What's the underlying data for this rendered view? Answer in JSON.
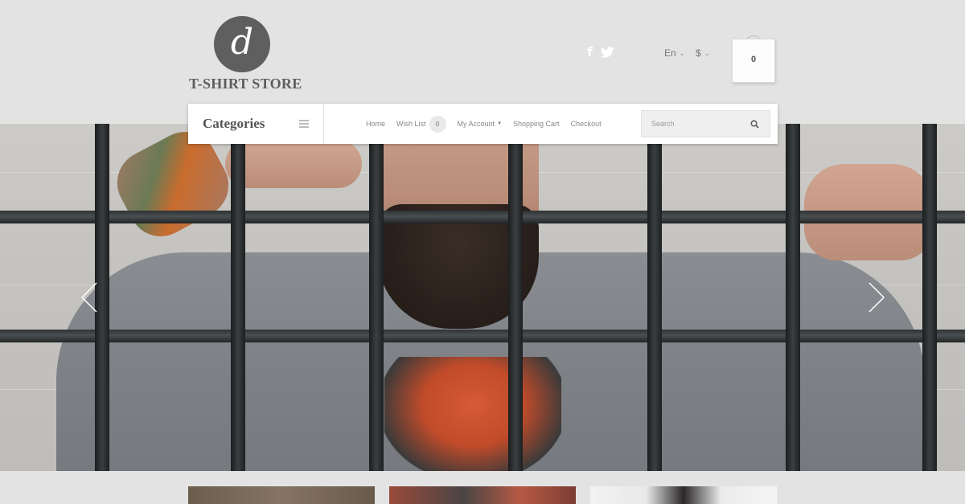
{
  "header": {
    "logo_letter": "d",
    "store_name": "T-SHIRT STORE",
    "language": "En",
    "currency": "$",
    "cart_count": "0",
    "social": {
      "facebook_icon": "f",
      "twitter_icon": "twitter-bird"
    }
  },
  "nav": {
    "categories_label": "Categories",
    "menu": {
      "home": "Home",
      "wishlist": "Wish List",
      "wishlist_count": "0",
      "account": "My Account",
      "cart": "Shopping Cart",
      "checkout": "Checkout"
    },
    "search": {
      "placeholder": "Search",
      "icon": "search-icon"
    }
  },
  "slider": {
    "prev_icon": "chevron-left-icon",
    "next_icon": "chevron-right-icon"
  },
  "colors": {
    "background": "#e3e3e3",
    "logo": "#5f5f5f",
    "nav_bg": "#ffffff"
  }
}
